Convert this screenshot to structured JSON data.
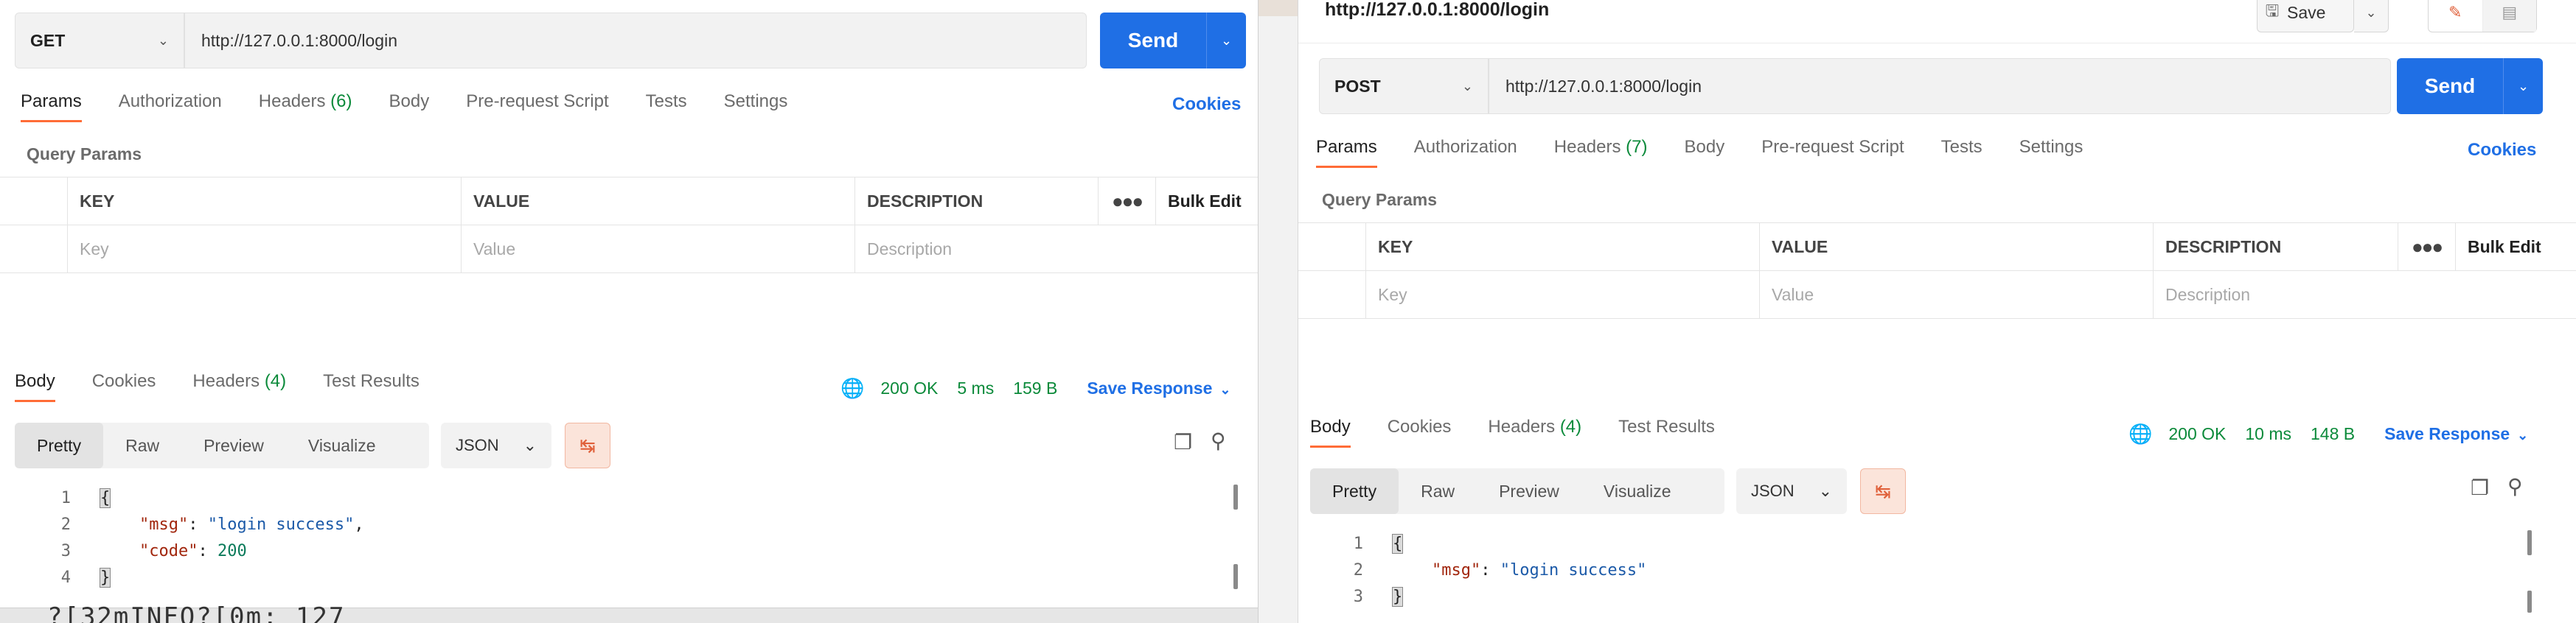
{
  "left": {
    "method": "GET",
    "url": "http://127.0.0.1:8000/login",
    "send_label": "Send",
    "tabs": [
      {
        "label": "Params",
        "count": ""
      },
      {
        "label": "Authorization",
        "count": ""
      },
      {
        "label": "Headers",
        "count": "(6)"
      },
      {
        "label": "Body",
        "count": ""
      },
      {
        "label": "Pre-request Script",
        "count": ""
      },
      {
        "label": "Tests",
        "count": ""
      },
      {
        "label": "Settings",
        "count": ""
      }
    ],
    "cookies": "Cookies",
    "query_params_title": "Query Params",
    "table": {
      "headers": [
        "KEY",
        "VALUE",
        "DESCRIPTION",
        "Bulk Edit"
      ],
      "placeholders": [
        "Key",
        "Value",
        "Description"
      ]
    },
    "response": {
      "tabs": [
        {
          "label": "Body",
          "count": ""
        },
        {
          "label": "Cookies",
          "count": ""
        },
        {
          "label": "Headers",
          "count": "(4)"
        },
        {
          "label": "Test Results",
          "count": ""
        }
      ],
      "status": "200 OK",
      "time": "5 ms",
      "size": "159 B",
      "save_response": "Save Response",
      "formats": [
        "Pretty",
        "Raw",
        "Preview",
        "Visualize"
      ],
      "language": "JSON",
      "code": [
        {
          "n": "1",
          "text": "{"
        },
        {
          "n": "2",
          "key": "\"msg\"",
          "sep": ": ",
          "val": "\"login success\"",
          "tail": ","
        },
        {
          "n": "3",
          "key": "\"code\"",
          "sep": ": ",
          "num": "200"
        },
        {
          "n": "4",
          "text": "}"
        }
      ]
    },
    "terminal_fragment": "?[32mINFO?[0m:     127"
  },
  "right": {
    "title": "http://127.0.0.1:8000/login",
    "save_label": "Save",
    "method": "POST",
    "url": "http://127.0.0.1:8000/login",
    "send_label": "Send",
    "tabs": [
      {
        "label": "Params",
        "count": ""
      },
      {
        "label": "Authorization",
        "count": ""
      },
      {
        "label": "Headers",
        "count": "(7)"
      },
      {
        "label": "Body",
        "count": ""
      },
      {
        "label": "Pre-request Script",
        "count": ""
      },
      {
        "label": "Tests",
        "count": ""
      },
      {
        "label": "Settings",
        "count": ""
      }
    ],
    "cookies": "Cookies",
    "query_params_title": "Query Params",
    "table": {
      "headers": [
        "KEY",
        "VALUE",
        "DESCRIPTION",
        "Bulk Edit"
      ],
      "placeholders": [
        "Key",
        "Value",
        "Description"
      ]
    },
    "response": {
      "tabs": [
        {
          "label": "Body",
          "count": ""
        },
        {
          "label": "Cookies",
          "count": ""
        },
        {
          "label": "Headers",
          "count": "(4)"
        },
        {
          "label": "Test Results",
          "count": ""
        }
      ],
      "status": "200 OK",
      "time": "10 ms",
      "size": "148 B",
      "save_response": "Save Response",
      "formats": [
        "Pretty",
        "Raw",
        "Preview",
        "Visualize"
      ],
      "language": "JSON",
      "code": [
        {
          "n": "1",
          "text": "{"
        },
        {
          "n": "2",
          "key": "\"msg\"",
          "sep": ": ",
          "val": "\"login success\""
        },
        {
          "n": "3",
          "text": "}"
        }
      ]
    }
  },
  "icons": {
    "save": "save-disk-icon",
    "edit": "pencil-icon",
    "comment": "comment-icon",
    "globe": "globe-icon",
    "copy": "copy-icon",
    "search": "search-icon",
    "wrap": "wrap-lines-icon",
    "chevron": "chevron-down-icon",
    "more": "more-horizontal-icon"
  },
  "colors": {
    "accent": "#ff6c37",
    "send": "#1f6fe5",
    "ok": "#0b8a3a"
  }
}
